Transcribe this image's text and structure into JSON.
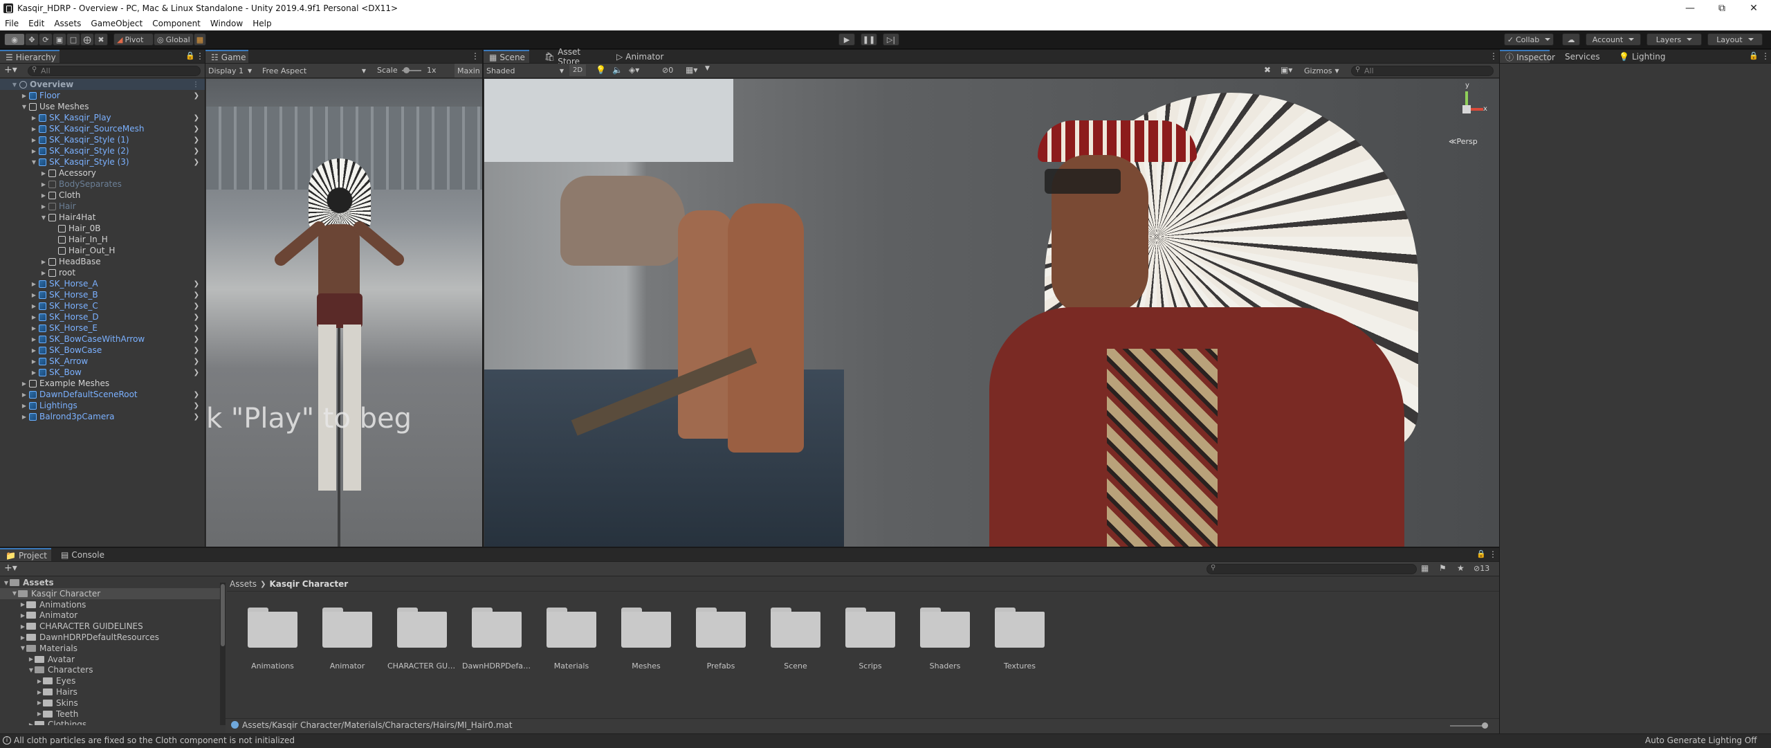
{
  "title_bar": {
    "title": "Kasqir_HDRP - Overview - PC, Mac & Linux Standalone - Unity 2019.4.9f1 Personal <DX11>"
  },
  "menu": [
    "File",
    "Edit",
    "Assets",
    "GameObject",
    "Component",
    "Window",
    "Help"
  ],
  "toolbar": {
    "pivot": "Pivot",
    "global": "Global",
    "collab": "Collab",
    "account": "Account",
    "layers": "Layers",
    "layout": "Layout"
  },
  "hierarchy": {
    "tab": "Hierarchy",
    "search_placeholder": "All",
    "items": [
      {
        "label": "Overview",
        "depth": 0,
        "type": "scene",
        "expanded": true
      },
      {
        "label": "Floor",
        "depth": 1,
        "type": "prefab",
        "expanded": false
      },
      {
        "label": "Use Meshes",
        "depth": 1,
        "type": "object",
        "expanded": true
      },
      {
        "label": "SK_Kasqir_Play",
        "depth": 2,
        "type": "prefab",
        "expanded": false
      },
      {
        "label": "SK_Kasqir_SourceMesh",
        "depth": 2,
        "type": "prefab",
        "expanded": false
      },
      {
        "label": "SK_Kasqir_Style (1)",
        "depth": 2,
        "type": "prefab",
        "expanded": false
      },
      {
        "label": "SK_Kasqir_Style (2)",
        "depth": 2,
        "type": "prefab",
        "expanded": false
      },
      {
        "label": "SK_Kasqir_Style (3)",
        "depth": 2,
        "type": "prefab",
        "expanded": true
      },
      {
        "label": "Acessory",
        "depth": 3,
        "type": "object",
        "expanded": false
      },
      {
        "label": "BodySeparates",
        "depth": 3,
        "type": "disabled",
        "expanded": false
      },
      {
        "label": "Cloth",
        "depth": 3,
        "type": "object",
        "expanded": false
      },
      {
        "label": "Hair",
        "depth": 3,
        "type": "disabled",
        "expanded": false
      },
      {
        "label": "Hair4Hat",
        "depth": 3,
        "type": "object",
        "expanded": true
      },
      {
        "label": "Hair_0B",
        "depth": 4,
        "type": "object",
        "expanded": null
      },
      {
        "label": "Hair_In_H",
        "depth": 4,
        "type": "object",
        "expanded": null
      },
      {
        "label": "Hair_Out_H",
        "depth": 4,
        "type": "object",
        "expanded": null
      },
      {
        "label": "HeadBase",
        "depth": 3,
        "type": "object",
        "expanded": false
      },
      {
        "label": "root",
        "depth": 3,
        "type": "object",
        "expanded": false
      },
      {
        "label": "SK_Horse_A",
        "depth": 2,
        "type": "prefab",
        "expanded": false
      },
      {
        "label": "SK_Horse_B",
        "depth": 2,
        "type": "prefab",
        "expanded": false
      },
      {
        "label": "SK_Horse_C",
        "depth": 2,
        "type": "prefab",
        "expanded": false
      },
      {
        "label": "SK_Horse_D",
        "depth": 2,
        "type": "prefab",
        "expanded": false
      },
      {
        "label": "SK_Horse_E",
        "depth": 2,
        "type": "prefab",
        "expanded": false
      },
      {
        "label": "SK_BowCaseWithArrow",
        "depth": 2,
        "type": "prefab",
        "expanded": false
      },
      {
        "label": "SK_BowCase",
        "depth": 2,
        "type": "prefab",
        "expanded": false
      },
      {
        "label": "SK_Arrow",
        "depth": 2,
        "type": "prefab",
        "expanded": false
      },
      {
        "label": "SK_Bow",
        "depth": 2,
        "type": "prefab",
        "expanded": false
      },
      {
        "label": "Example Meshes",
        "depth": 1,
        "type": "object",
        "expanded": false
      },
      {
        "label": "DawnDefaultSceneRoot",
        "depth": 1,
        "type": "prefab",
        "expanded": false
      },
      {
        "label": "Lightings",
        "depth": 1,
        "type": "prefab",
        "expanded": false
      },
      {
        "label": "Balrond3pCamera",
        "depth": 1,
        "type": "prefab",
        "expanded": false
      }
    ]
  },
  "game": {
    "tab": "Game",
    "display": "Display 1",
    "aspect": "Free Aspect",
    "scale_label": "Scale",
    "scale_value": "1x",
    "maximize": "Maxin",
    "overlay_text": "k \"Play\" to beg"
  },
  "scene": {
    "tabs": [
      "Scene",
      "Asset Store",
      "Animator"
    ],
    "shading": "Shaded",
    "mode_2d": "2D",
    "fx_count": "0",
    "gizmos": "Gizmos",
    "search_placeholder": "All",
    "persp": "Persp",
    "gizmo_y": "y",
    "gizmo_x": "x"
  },
  "inspector": {
    "tabs": [
      "Inspector",
      "Services",
      "Lighting"
    ]
  },
  "project": {
    "tabs": [
      "Project",
      "Console"
    ],
    "tree": [
      {
        "label": "Assets",
        "depth": 0,
        "bold": true,
        "open": true
      },
      {
        "label": "Kasqir Character",
        "depth": 1,
        "bold": false,
        "open": true,
        "selected": true
      },
      {
        "label": "Animations",
        "depth": 2,
        "open": false
      },
      {
        "label": "Animator",
        "depth": 2,
        "open": false
      },
      {
        "label": "CHARACTER GUIDELINES",
        "depth": 2,
        "open": false
      },
      {
        "label": "DawnHDRPDefaultResources",
        "depth": 2,
        "open": false
      },
      {
        "label": "Materials",
        "depth": 2,
        "open": true
      },
      {
        "label": "Avatar",
        "depth": 3,
        "open": false
      },
      {
        "label": "Characters",
        "depth": 3,
        "open": true
      },
      {
        "label": "Eyes",
        "depth": 4,
        "open": false
      },
      {
        "label": "Hairs",
        "depth": 4,
        "open": false
      },
      {
        "label": "Skins",
        "depth": 4,
        "open": false
      },
      {
        "label": "Teeth",
        "depth": 4,
        "open": false
      },
      {
        "label": "Clothings",
        "depth": 3,
        "open": false
      }
    ],
    "breadcrumb": [
      "Assets",
      "Kasqir Character"
    ],
    "folders": [
      "Animations",
      "Animator",
      "CHARACTER GUI...",
      "DawnHDRPDefaul...",
      "Materials",
      "Meshes",
      "Prefabs",
      "Scene",
      "Scrips",
      "Shaders",
      "Textures"
    ],
    "hidden_count": "13",
    "selected_path": "Assets/Kasqir Character/Materials/Characters/Hairs/MI_Hair0.mat"
  },
  "status": {
    "message": "All cloth particles are fixed so the Cloth component is not initialized",
    "right": "Auto Generate Lighting Off"
  },
  "colors": {
    "accent": "#3a79bb",
    "prefab_text": "#7bb1ff",
    "panel": "#383838"
  }
}
